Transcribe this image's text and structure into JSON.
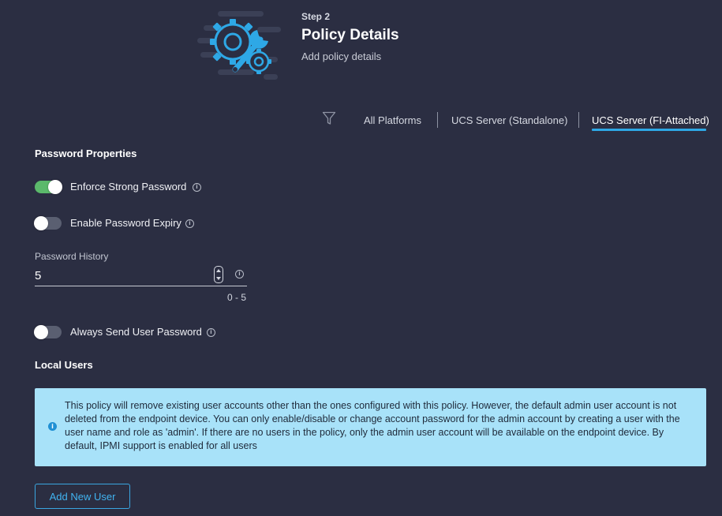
{
  "header": {
    "step": "Step 2",
    "title": "Policy Details",
    "subtitle": "Add policy details"
  },
  "tabs": [
    {
      "label": "All Platforms",
      "active": false
    },
    {
      "label": "UCS Server (Standalone)",
      "active": false
    },
    {
      "label": "UCS Server (FI-Attached)",
      "active": true
    }
  ],
  "password_properties": {
    "section_title": "Password Properties",
    "enforce_strong": {
      "label": "Enforce Strong Password",
      "enabled": true
    },
    "password_expiry": {
      "label": "Enable Password Expiry",
      "enabled": false
    },
    "history": {
      "label": "Password History",
      "value": "5",
      "range": "0 - 5"
    },
    "always_send": {
      "label": "Always Send User Password",
      "enabled": false
    }
  },
  "local_users": {
    "section_title": "Local Users",
    "notice": "This policy will remove existing user accounts other than the ones configured with this policy. However, the default admin user account is not deleted from the endpoint device. You can only enable/disable or change account password for the admin account by creating a user with the user name and role as 'admin'. If there are no users in the policy, only the admin user account will be available on the endpoint device. By default, IPMI support is enabled for all users",
    "add_button": "Add New User"
  },
  "colors": {
    "background": "#2b2e42",
    "toggle_on": "#5bb96b",
    "accent": "#2ea8e6",
    "banner": "#a8e2f9"
  },
  "icons": {
    "hero": "gear-wrench-icon",
    "filter": "filter-icon",
    "info": "info-icon",
    "stepper": "stepper-icon"
  }
}
